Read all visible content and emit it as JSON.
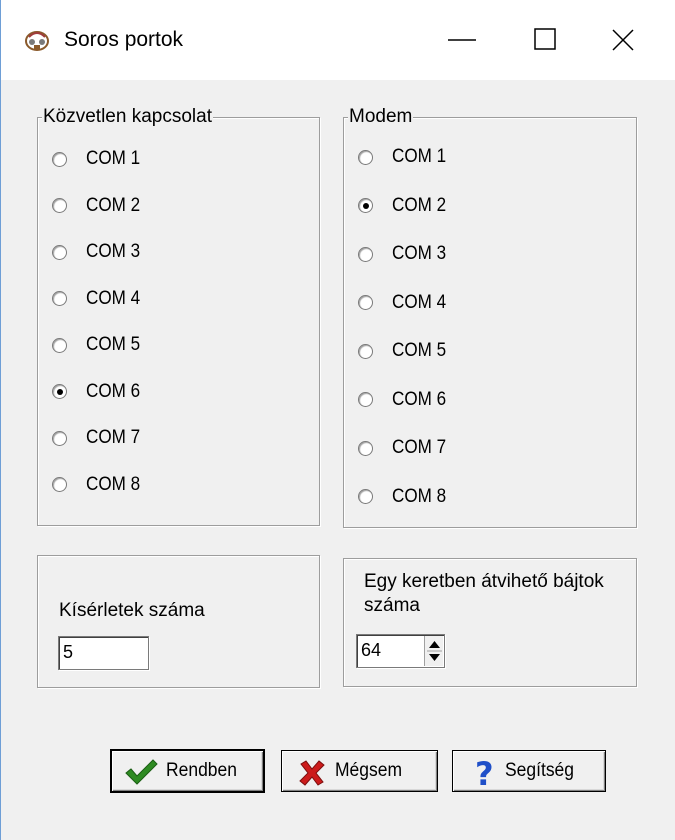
{
  "window": {
    "title": "Soros portok",
    "icons": {
      "app": "app-logo-icon",
      "minimize": "minimize-icon",
      "maximize": "maximize-icon",
      "close": "close-icon"
    }
  },
  "direct_group": {
    "legend": "Közvetlen kapcsolat",
    "options": [
      {
        "label": "COM 1",
        "checked": false
      },
      {
        "label": "COM 2",
        "checked": false
      },
      {
        "label": "COM 3",
        "checked": false
      },
      {
        "label": "COM 4",
        "checked": false
      },
      {
        "label": "COM 5",
        "checked": false
      },
      {
        "label": "COM 6",
        "checked": true
      },
      {
        "label": "COM 7",
        "checked": false
      },
      {
        "label": "COM 8",
        "checked": false
      }
    ]
  },
  "modem_group": {
    "legend": "Modem",
    "options": [
      {
        "label": "COM 1",
        "checked": false
      },
      {
        "label": "COM 2",
        "checked": true
      },
      {
        "label": "COM 3",
        "checked": false
      },
      {
        "label": "COM 4",
        "checked": false
      },
      {
        "label": "COM 5",
        "checked": false
      },
      {
        "label": "COM 6",
        "checked": false
      },
      {
        "label": "COM 7",
        "checked": false
      },
      {
        "label": "COM 8",
        "checked": false
      }
    ]
  },
  "attempts": {
    "label": "Kísérletek száma",
    "value": "5"
  },
  "bytes_per_frame": {
    "label_line1": "Egy keretben átvihető bájtok",
    "label_line2": "száma",
    "value": "64"
  },
  "buttons": {
    "ok": {
      "label": "Rendben",
      "icon": "checkmark-icon",
      "icon_color": "#2e8b22"
    },
    "cancel": {
      "label": "Mégsem",
      "icon": "red-x-icon",
      "icon_color": "#cc1b1b"
    },
    "help": {
      "label": "Segítség",
      "icon": "question-mark-icon",
      "icon_color": "#1f4fc8"
    }
  }
}
